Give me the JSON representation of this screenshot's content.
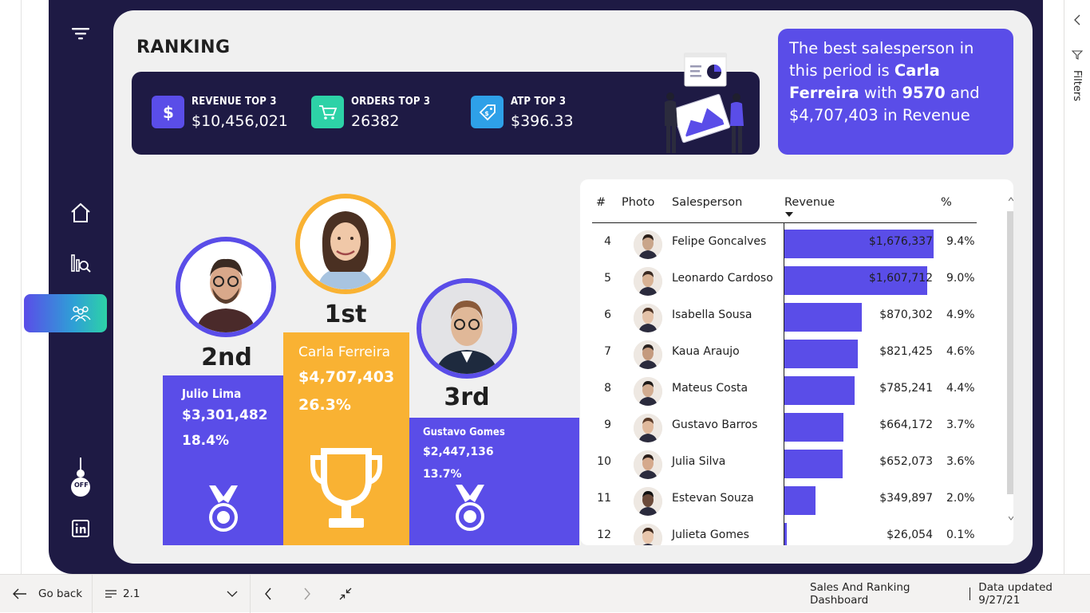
{
  "page": {
    "title": "RANKING"
  },
  "sidebar": {
    "icons": [
      "filter-icon",
      "home-icon",
      "search-chart-icon",
      "people-icon",
      "off-toggle-icon",
      "linkedin-icon"
    ],
    "toggle_label": "OFF"
  },
  "kpis": [
    {
      "label": "REVENUE TOP 3",
      "value": "$10,456,021",
      "icon": "dollar-icon",
      "color": "#5a4de8"
    },
    {
      "label": "ORDERS TOP 3",
      "value": "26382",
      "icon": "cart-icon",
      "color": "#2dd2a7"
    },
    {
      "label": "ATP TOP 3",
      "value": "$396.33",
      "icon": "tag-icon",
      "color": "#2ea0e8"
    }
  ],
  "best_card": {
    "prefix": "The best salesperson in this period is ",
    "name": "Carla Ferreira",
    "middle": " with ",
    "orders": "9570",
    "suffix": " and $4,707,403 in Revenue"
  },
  "podium": {
    "first": {
      "place": "1st",
      "name": "Carla Ferreira",
      "revenue": "$4,707,403",
      "pct": "26.3%",
      "color": "#f9b233"
    },
    "second": {
      "place": "2nd",
      "name": "Julio Lima",
      "revenue": "$3,301,482",
      "pct": "18.4%",
      "color": "#5a4de8"
    },
    "third": {
      "place": "3rd",
      "name": "Gustavo Gomes",
      "revenue": "$2,447,136",
      "pct": "13.7%",
      "color": "#5a4de8"
    }
  },
  "table": {
    "headers": {
      "rank": "#",
      "photo": "Photo",
      "salesperson": "Salesperson",
      "revenue": "Revenue",
      "pct": "%"
    },
    "sort_column": "Revenue",
    "sort_direction": "descending",
    "bar_color": "#5a4de8",
    "rows": [
      {
        "rank": "4",
        "name": "Felipe Goncalves",
        "revenue": "$1,676,337",
        "pct": "9.4%",
        "value": 1676337
      },
      {
        "rank": "5",
        "name": "Leonardo Cardoso",
        "revenue": "$1,607,712",
        "pct": "9.0%",
        "value": 1607712
      },
      {
        "rank": "6",
        "name": "Isabella Sousa",
        "revenue": "$870,302",
        "pct": "4.9%",
        "value": 870302
      },
      {
        "rank": "7",
        "name": "Kaua Araujo",
        "revenue": "$821,425",
        "pct": "4.6%",
        "value": 821425
      },
      {
        "rank": "8",
        "name": "Mateus Costa",
        "revenue": "$785,241",
        "pct": "4.4%",
        "value": 785241
      },
      {
        "rank": "9",
        "name": "Gustavo Barros",
        "revenue": "$664,172",
        "pct": "3.7%",
        "value": 664172
      },
      {
        "rank": "10",
        "name": "Julia Silva",
        "revenue": "$652,073",
        "pct": "3.6%",
        "value": 652073
      },
      {
        "rank": "11",
        "name": "Estevan Souza",
        "revenue": "$349,897",
        "pct": "2.0%",
        "value": 349897
      },
      {
        "rank": "12",
        "name": "Julieta Gomes",
        "revenue": "$26,054",
        "pct": "0.1%",
        "value": 26054
      }
    ]
  },
  "statusbar": {
    "go_back": "Go back",
    "page_selector": "2.1",
    "report_name": "Sales And Ranking Dashboard",
    "data_updated": "Data updated 9/27/21"
  },
  "filters_pane": {
    "label": "Filters"
  }
}
